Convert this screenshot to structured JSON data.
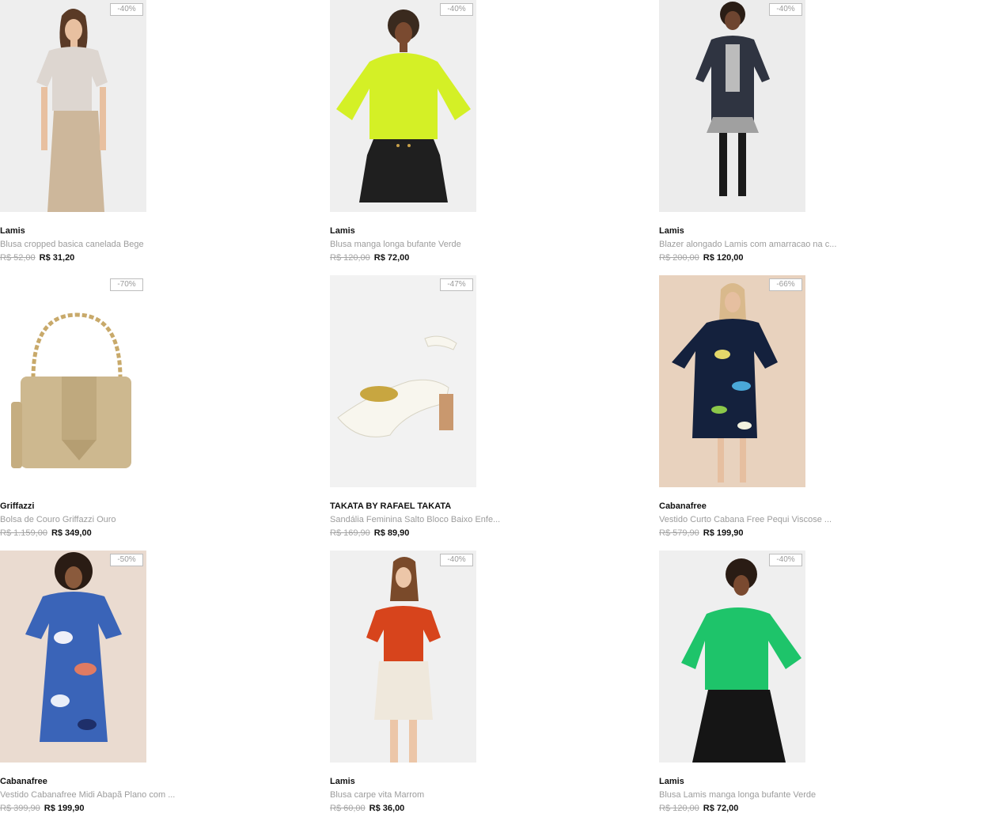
{
  "products": [
    {
      "discount": "-40%",
      "brand": "Lamis",
      "name": "Blusa cropped basica canelada Bege",
      "old_price": "R$ 52,00",
      "price": "R$ 31,20",
      "image": "model-beige-top-khaki-skirt"
    },
    {
      "discount": "-40%",
      "brand": "Lamis",
      "name": "Blusa manga longa bufante Verde",
      "old_price": "R$ 120,00",
      "price": "R$ 72,00",
      "image": "model-lime-sweater-black-skirt"
    },
    {
      "discount": "-40%",
      "brand": "Lamis",
      "name": "Blazer alongado Lamis com amarracao na c...",
      "old_price": "R$ 200,00",
      "price": "R$ 120,00",
      "image": "model-navy-blazer"
    },
    {
      "discount": "-70%",
      "brand": "Griffazzi",
      "name": "Bolsa de Couro Griffazzi Ouro",
      "old_price": "R$ 1.159,00",
      "price": "R$ 349,00",
      "image": "gold-leather-handbag"
    },
    {
      "discount": "-47%",
      "brand": "TAKATA BY RAFAEL TAKATA",
      "name": "Sandália Feminina Salto Bloco Baixo Enfe...",
      "old_price": "R$ 169,90",
      "price": "R$ 89,90",
      "image": "white-block-heel-sandal"
    },
    {
      "discount": "-66%",
      "brand": "Cabanafree",
      "name": "Vestido Curto Cabana Free Pequi Viscose ...",
      "old_price": "R$ 579,90",
      "price": "R$ 199,90",
      "image": "model-printed-short-dress"
    },
    {
      "discount": "-50%",
      "brand": "Cabanafree",
      "name": "Vestido Cabanafree Midi Abapã Plano com ...",
      "old_price": "R$ 399,90",
      "price": "R$ 199,90",
      "image": "model-blue-print-midi-dress"
    },
    {
      "discount": "-40%",
      "brand": "Lamis",
      "name": "Blusa carpe vita Marrom",
      "old_price": "R$ 60,00",
      "price": "R$ 36,00",
      "image": "model-orange-tee-white-skirt"
    },
    {
      "discount": "-40%",
      "brand": "Lamis",
      "name": "Blusa Lamis manga longa bufante Verde",
      "old_price": "R$ 120,00",
      "price": "R$ 72,00",
      "image": "model-green-sweater-black-skirt"
    }
  ],
  "colors": {
    "brand_text": "#111111",
    "name_text": "#9c9c9c",
    "old_price_text": "#a5a5a5",
    "badge_border": "#bdbdbd"
  }
}
